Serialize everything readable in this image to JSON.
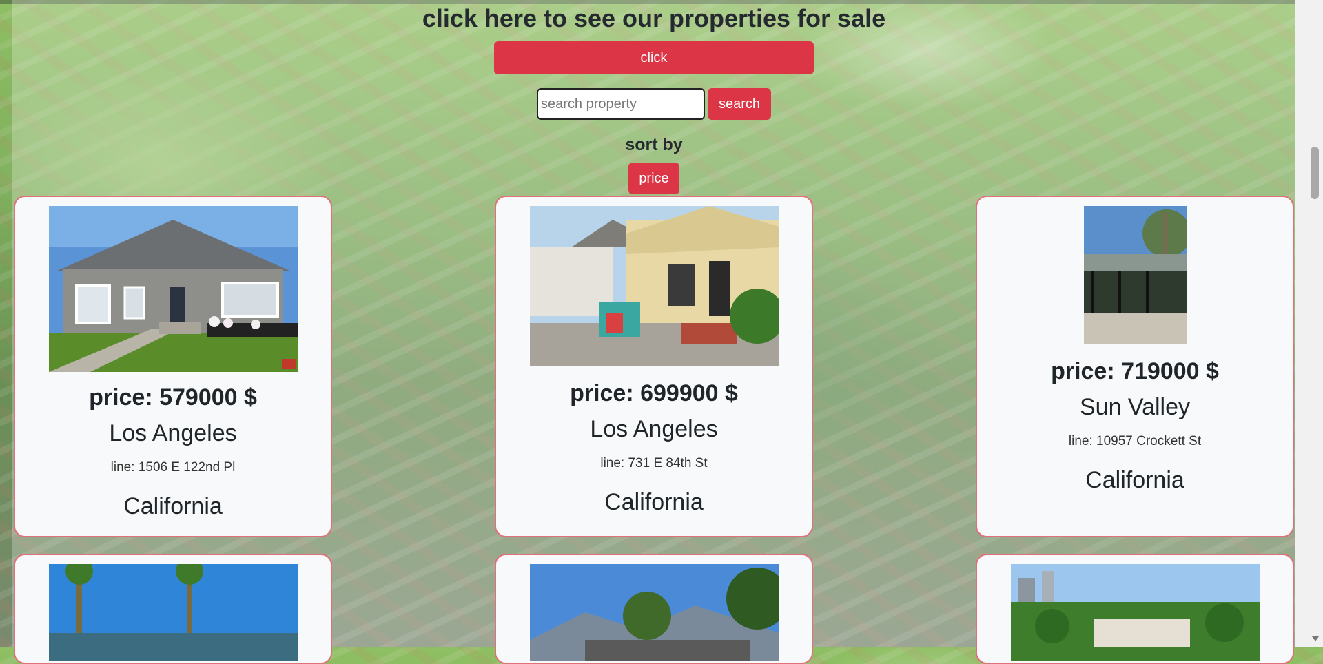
{
  "header": {
    "headline": "click here to see our properties for sale",
    "click_label": "click"
  },
  "search": {
    "placeholder": "search property",
    "value": "",
    "button_label": "search"
  },
  "sort": {
    "label": "sort by",
    "price_label": "price"
  },
  "listings": [
    {
      "price": "price: 579000 $",
      "city": "Los Angeles",
      "line": "line: 1506 E 122nd Pl",
      "state": "California"
    },
    {
      "price": "price: 699900 $",
      "city": "Los Angeles",
      "line": "line: 731 E 84th St",
      "state": "California"
    },
    {
      "price": "price: 719000 $",
      "city": "Sun Valley",
      "line": "line: 10957 Crockett St",
      "state": "California"
    }
  ],
  "colors": {
    "accent": "#dc3545",
    "card_border": "#e0707a",
    "card_bg": "#f8f9fa"
  }
}
